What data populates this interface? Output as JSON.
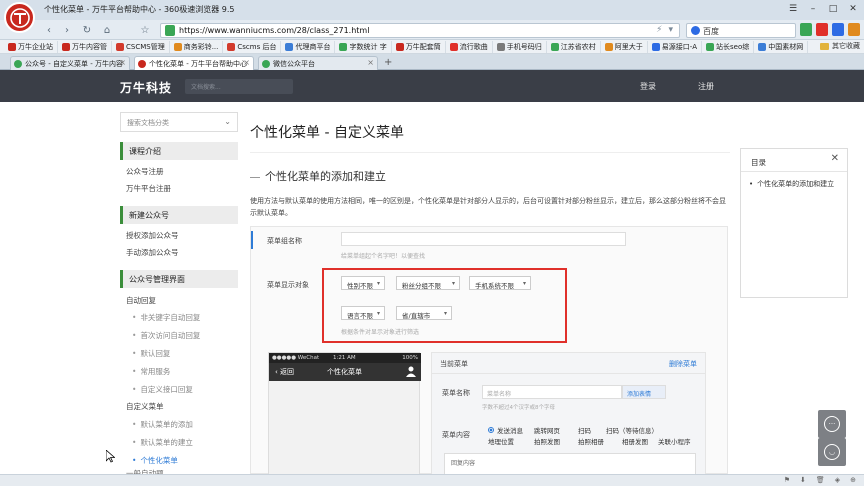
{
  "browser": {
    "window_title": "个性化菜单 - 万牛平台帮助中心 - 360极速浏览器 9.5",
    "url": "https://www.wanniucms.com/28/class_271.html",
    "search_engine": "百度",
    "bookmarks": [
      {
        "label": "万牛企业站",
        "color": "#c8281e"
      },
      {
        "label": "万牛内容管",
        "color": "#c8281e"
      },
      {
        "label": "CSCMS管理",
        "color": "#d23a2c"
      },
      {
        "label": "商务彩铃...",
        "color": "#e08a1e"
      },
      {
        "label": "Cscms 后台",
        "color": "#d23a2c"
      },
      {
        "label": "代理商平台",
        "color": "#3c7dd6"
      },
      {
        "label": "字数统计 字",
        "color": "#3aa655"
      },
      {
        "label": "万牛配套筒",
        "color": "#c8281e"
      },
      {
        "label": "流行歌曲",
        "color": "#e0302a"
      },
      {
        "label": "手机号码归",
        "color": "#7a7a7a"
      },
      {
        "label": "江苏省农村",
        "color": "#3aa655"
      },
      {
        "label": "阿里大于",
        "color": "#e08a1e"
      },
      {
        "label": "易源接口-A",
        "color": "#2d6be4"
      },
      {
        "label": "站长seo综",
        "color": "#3aa655"
      },
      {
        "label": "中国素材网",
        "color": "#3c7dd6"
      }
    ],
    "bookmarks_more": "其它收藏",
    "tabs": [
      {
        "label": "公众号 - 自定义菜单 - 万牛内容",
        "active": false,
        "color": "#3aa655"
      },
      {
        "label": "个性化菜单 - 万牛平台帮助中心",
        "active": true,
        "color": "#c8281e"
      },
      {
        "label": "微信公众平台",
        "color": "#3aa655",
        "active": false
      }
    ]
  },
  "site": {
    "brand": "万牛科技",
    "search_placeholder": "文档搜索...",
    "login": "登录",
    "register": "注册"
  },
  "sidebar": {
    "select_placeholder": "搜索文档分类",
    "sections": [
      {
        "title": "课程介绍",
        "items": [
          "公众号注册",
          "万牛平台注册"
        ]
      },
      {
        "title": "新建公众号",
        "items": [
          "授权添加公众号",
          "手动添加公众号"
        ]
      },
      {
        "title": "公众号管理界面",
        "items": [
          "自动回复"
        ]
      }
    ],
    "auto_reply_subs": [
      "非关键字自动回复",
      "首次访问自动回复",
      "默认回复",
      "常用服务",
      "自定义接口回复"
    ],
    "custom_menu_label": "自定义菜单",
    "custom_menu_subs": [
      "默认菜单的添加",
      "默认菜单的建立",
      "个性化菜单"
    ],
    "next_item": "一般自动题"
  },
  "main": {
    "title": "个性化菜单 - 自定义菜单",
    "section_heading": "个性化菜单的添加和建立",
    "intro": "使用方法与默认菜单的使用方法相同，唯一的区别是，个性化菜单是针对部分人显示的，后台可设置针对部分粉丝显示，建立后，那么这部分粉丝将不会显示默认菜单。",
    "form": {
      "menu_group_label": "菜单组名称",
      "menu_group_hint": "给菜单组起个名字吧！以便查找",
      "display_target_label": "菜单显示对象",
      "filters_row1": [
        "性别不限",
        "粉丝分组不限",
        "手机系统不限"
      ],
      "filters_row2": [
        "语言不限",
        "省/直辖市"
      ],
      "filter_hint": "根据条件对显示对象进行筛选"
    },
    "phone": {
      "carrier": "●●●●● WeChat",
      "time": "1:21 AM",
      "battery": "100%",
      "back": "返回",
      "title": "个性化菜单"
    },
    "editor": {
      "current_menu": "当前菜单",
      "delete_menu": "删除菜单",
      "name_label": "菜单名称",
      "name_placeholder": "菜单名称",
      "add_expression": "添加表情",
      "name_hint": "字数不超过4个汉字或8个字母",
      "content_label": "菜单内容",
      "options_row1": [
        "发送消息",
        "跳转网页",
        "扫码",
        "扫码（等待信息）"
      ],
      "options_row2": [
        "地理位置",
        "拍照发图",
        "拍照相册",
        "相册发图",
        "关联小程序"
      ],
      "reply_label": "回复内容"
    }
  },
  "toc": {
    "title": "目录",
    "items": [
      "个性化菜单的添加和建立"
    ]
  }
}
